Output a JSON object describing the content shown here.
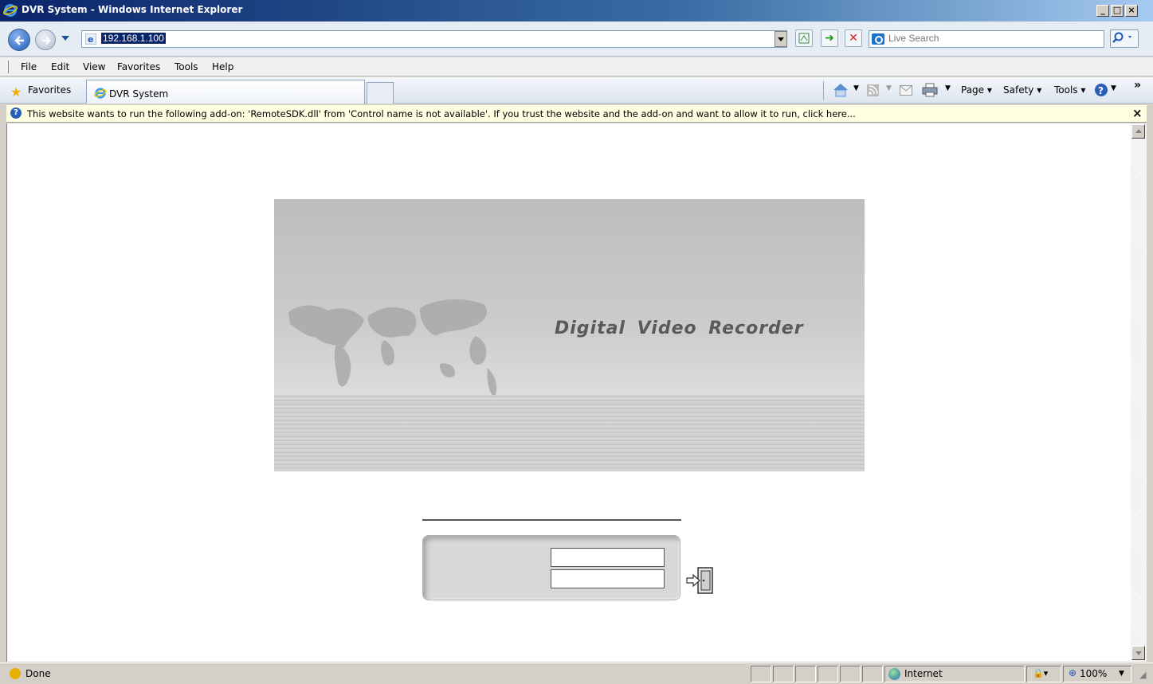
{
  "window": {
    "title": "DVR System - Windows Internet Explorer",
    "min_glyph": "_",
    "max_glyph": "□",
    "close_glyph": "×"
  },
  "address_bar": {
    "url": "192.168.1.100",
    "search_placeholder": "Live Search"
  },
  "menu": {
    "items": [
      "File",
      "Edit",
      "View",
      "Favorites",
      "Tools",
      "Help"
    ]
  },
  "favorites_bar": {
    "favorites_label": "Favorites",
    "tab_label": "DVR System",
    "commands": [
      "Page ▾",
      "Safety ▾",
      "Tools ▾"
    ]
  },
  "infobar": {
    "message": "This website wants to run the following add-on: 'RemoteSDK.dll' from 'Control name is not available'. If you trust the website and the add-on and want to allow it to run, click here...",
    "close_glyph": "×"
  },
  "page": {
    "banner_title": "Digital Video Recorder",
    "username_value": "",
    "password_value": ""
  },
  "status": {
    "text": "Done",
    "zone": "Internet",
    "zoom": "100%"
  }
}
